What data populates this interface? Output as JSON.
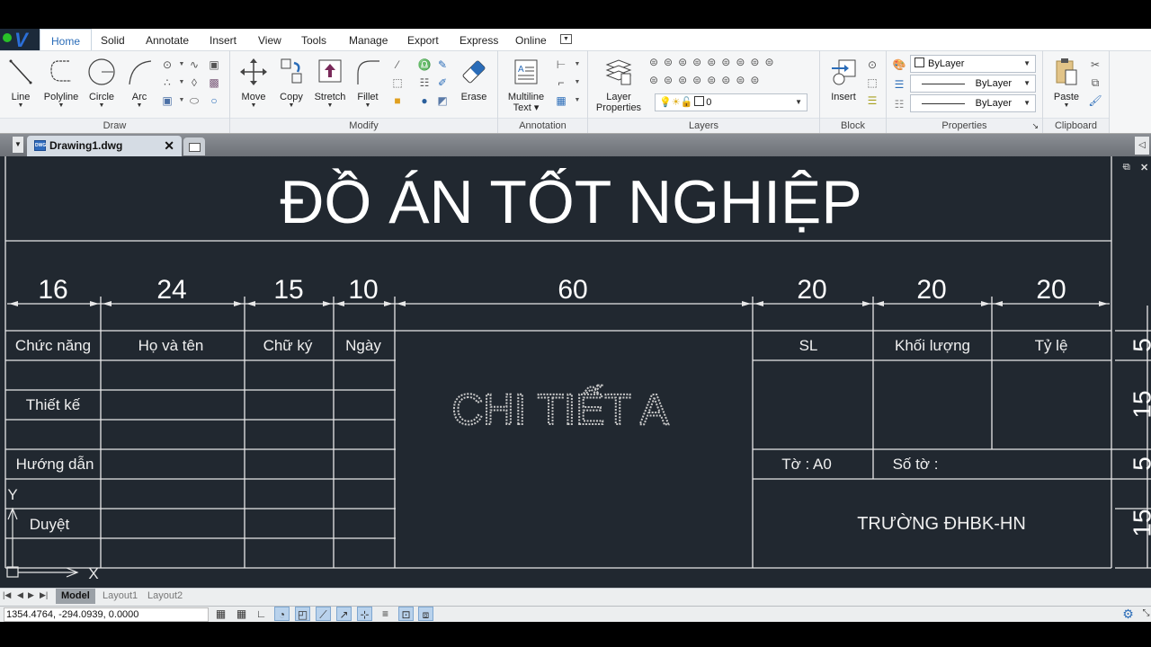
{
  "ribbon": {
    "tabs": [
      "Home",
      "Solid",
      "Annotate",
      "Insert",
      "View",
      "Tools",
      "Manage",
      "Export",
      "Express",
      "Online"
    ],
    "active_tab": "Home",
    "panels": {
      "draw": {
        "title": "Draw",
        "buttons": [
          "Line",
          "Polyline",
          "Circle",
          "Arc"
        ]
      },
      "modify": {
        "title": "Modify",
        "buttons": [
          "Move",
          "Copy",
          "Stretch",
          "Fillet",
          "Erase"
        ]
      },
      "annotation": {
        "title": "Annotation",
        "buttons": [
          "Multiline",
          "Text ▾"
        ]
      },
      "layers": {
        "title": "Layers",
        "layer_properties": [
          "Layer",
          "Properties"
        ],
        "current_layer": "0"
      },
      "block": {
        "title": "Block",
        "insert": "Insert"
      },
      "properties": {
        "title": "Properties",
        "color": "ByLayer",
        "linetype": "ByLayer",
        "lineweight": "ByLayer"
      },
      "clipboard": {
        "title": "Clipboard",
        "paste": "Paste"
      }
    }
  },
  "document_tabs": [
    {
      "name": "Drawing1.dwg",
      "icon": "DWG",
      "active": true
    }
  ],
  "drawing": {
    "title": "ĐỒ ÁN TỐT NGHIỆP",
    "column_dimensions": [
      "16",
      "24",
      "15",
      "10",
      "60",
      "20",
      "20",
      "20"
    ],
    "row_dimensions": [
      "5",
      "15",
      "5",
      "15"
    ],
    "header_left": [
      "Chức năng",
      "Họ và tên",
      "Chữ ký",
      "Ngày"
    ],
    "header_right": [
      "SL",
      "Khối lượng",
      "Tỷ lệ"
    ],
    "role_labels": [
      "Thiết kế",
      "Hướng dẫn",
      "Duyệt"
    ],
    "center_label": "CHI TIẾT A",
    "sheet_size": "Tờ : A0",
    "sheet_number": "Số tờ :",
    "school": "TRƯỜNG ĐHBK-HN",
    "ucs_x": "X",
    "ucs_y": "Y"
  },
  "layout_tabs": [
    "Model",
    "Layout1",
    "Layout2"
  ],
  "active_layout": "Model",
  "status": {
    "coordinates": "1354.4764, -294.0939, 0.0000"
  },
  "colors": {
    "canvas": "#212830",
    "line": "#e8e8e8",
    "accent": "#2a6cb8"
  }
}
